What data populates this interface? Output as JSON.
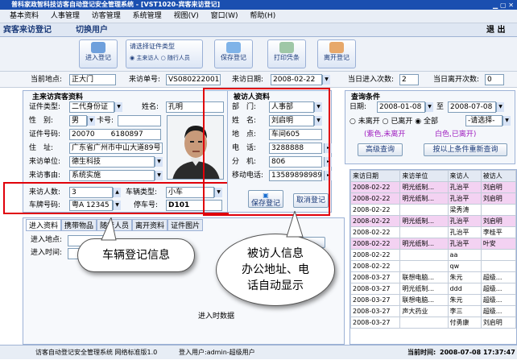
{
  "window": {
    "title": "普科家政智科技访客自动登记安全管理系统 - [VST1020-宾客来访登记]"
  },
  "menu": [
    "基本资料",
    "人事管理",
    "访客管理",
    "系统管理",
    "视图(V)",
    "窗口(W)",
    "帮助(H)"
  ],
  "tab": {
    "label": "宾客来访登记",
    "switch_label": "切换用户",
    "exit_label": "退 出"
  },
  "toolbar": {
    "enter_label": "进入登记",
    "select_label": "请选择证件类型",
    "radio_host": "主来访人",
    "radio_companion": "随行人员",
    "save_label": "保存登记",
    "print_label": "打印凭条",
    "leave_label": "离开登记"
  },
  "info": {
    "location_label": "当前地点:",
    "location": "正大门",
    "visit_no_label": "来访单号:",
    "visit_no": "VS080222001",
    "visit_date_label": "来访日期:",
    "visit_date": "2008-02-22",
    "today_in_label": "当日进入次数:",
    "today_in": "2",
    "today_out_label": "当日离开次数:",
    "today_out": "0"
  },
  "visitor": {
    "section_title": "主来访宾客资料",
    "id_type_label": "证件类型:",
    "id_type": "二代身份证",
    "name_label": "姓名:",
    "name": "孔明",
    "gender_label": "性　别:",
    "gender": "男",
    "card_label": "卡号:",
    "card": "",
    "id_no_label": "证件号码:",
    "id_no": "20070",
    "id_no_tail": "6180897",
    "address_label": "住　址:",
    "address": "广东省广州市中山大道89号",
    "company_label": "来访单位:",
    "company": "德生科技",
    "reason_label": "来访事由:",
    "reason": "系统实施",
    "count_label": "来访人数:",
    "count": "3",
    "vehicle_type_label": "车辆类型:",
    "vehicle_type": "小车",
    "plate_label": "车牌号码:",
    "plate": "粤A 12345",
    "parking_label": "停车号:",
    "parking": "D101"
  },
  "host": {
    "section_title": "被访人资料",
    "dept_label": "部　门:",
    "dept": "人事部",
    "name_label": "姓　名:",
    "name": "刘启明",
    "addr_label": "地　点:",
    "addr": "车间605",
    "phone_label": "电　话:",
    "phone": "3288888",
    "ext_label": "分　机:",
    "ext": "806",
    "mobile_label": "移动电话:",
    "mobile": "13589898989",
    "save_label": "保存登记",
    "cancel_label": "取消登记"
  },
  "query": {
    "section_title": "查询条件",
    "date_label": "日期:",
    "date_from": "2008-01-08",
    "to_label": "至",
    "date_to": "2008-07-08",
    "opt_not_left": "未离开",
    "opt_left": "已离开",
    "opt_all": "全部",
    "opt_select": "-请选择-",
    "legend_purple": "(紫色,未离开",
    "legend_white": "白色,已离开)",
    "advanced_label": "高级查询",
    "requery_label": "按以上条件重新查询"
  },
  "bottom_tabs": [
    "进入资料",
    "携带物品",
    "随行人员",
    "离开资料",
    "证件图片"
  ],
  "bottom": {
    "enter_loc_label": "进入地点:",
    "enter_time_label": "进入时间:",
    "enter_guard_label": "进入时数据"
  },
  "records": {
    "headers": [
      "来访日期",
      "来访单位",
      "来访人",
      "被访人"
    ],
    "rows": [
      {
        "date": "2008-02-22",
        "company": "明光纸制...",
        "visitor": "孔治平",
        "host": "刘启明",
        "pending": true
      },
      {
        "date": "2008-02-22",
        "company": "明光纸制...",
        "visitor": "孔治平",
        "host": "刘启明",
        "pending": true
      },
      {
        "date": "2008-02-22",
        "company": "",
        "visitor": "梁秀涛",
        "host": "",
        "pending": false
      },
      {
        "date": "2008-02-22",
        "company": "明光纸制...",
        "visitor": "孔治平",
        "host": "刘启明",
        "pending": true
      },
      {
        "date": "2008-02-22",
        "company": "",
        "visitor": "孔治平",
        "host": "李桂平",
        "pending": false
      },
      {
        "date": "2008-02-22",
        "company": "明光纸制...",
        "visitor": "孔治平",
        "host": "叶安",
        "pending": true
      },
      {
        "date": "2008-02-22",
        "company": "",
        "visitor": "aa",
        "host": "",
        "pending": false
      },
      {
        "date": "2008-02-22",
        "company": "",
        "visitor": "qw",
        "host": "",
        "pending": false
      },
      {
        "date": "2008-03-27",
        "company": "联想电脑...",
        "visitor": "朱元",
        "host": "超级...",
        "pending": false
      },
      {
        "date": "2008-03-27",
        "company": "明光纸制...",
        "visitor": "ddd",
        "host": "超级...",
        "pending": false
      },
      {
        "date": "2008-03-27",
        "company": "联想电脑...",
        "visitor": "朱元",
        "host": "超级...",
        "pending": false
      },
      {
        "date": "2008-03-27",
        "company": "声大药业",
        "visitor": "李三",
        "host": "超级...",
        "pending": false
      },
      {
        "date": "2008-03-27",
        "company": "",
        "visitor": "付勇康",
        "host": "刘启明",
        "pending": false
      }
    ]
  },
  "callouts": {
    "vehicle": "车辆登记信息",
    "host_line1": "被访人信息",
    "host_line2": "办公地址、电",
    "host_line3": "话自动显示"
  },
  "status": {
    "app": "访客自动登记安全管理系统 网络标准版1.0",
    "user": "登入用户:admin-超级用户",
    "time_label": "当前时间:",
    "time": "2008-07-08 17:37:47"
  },
  "colors": {
    "pending_row": "#f3d2f2",
    "callout_border": "#e0000a",
    "title_blue": "#1a4fb0"
  }
}
